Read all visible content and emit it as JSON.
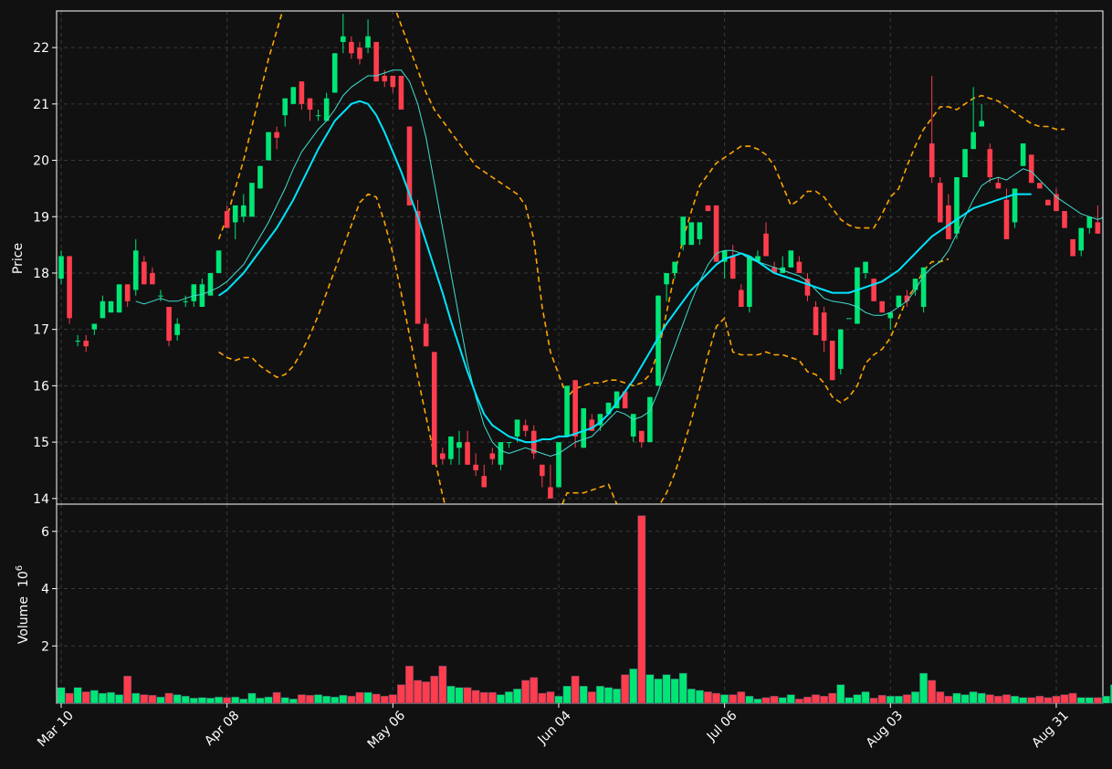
{
  "chart_data": {
    "type": "candlestick",
    "colors": {
      "background": "#111111",
      "grid": "#3a3a3a",
      "up": "#00e676",
      "down": "#ff3d4d",
      "ma_fast": "#40e0d0",
      "ma_slow": "#00e5ff",
      "bollinger": "#ffa500",
      "axis": "#ffffff"
    },
    "price_panel": {
      "ylabel": "Price",
      "ylim": [
        13.9,
        22.65
      ],
      "yticks": [
        "14",
        "15",
        "16",
        "17",
        "18",
        "19",
        "20",
        "21",
        "22"
      ]
    },
    "volume_panel": {
      "ylabel": "Volume",
      "ylabel_multiplier": "10",
      "ylabel_exponent": "6",
      "ylim": [
        0,
        6.95
      ],
      "yticks": [
        "2",
        "4",
        "6"
      ]
    },
    "x_tick_labels": [
      "Mar 10",
      "Apr 08",
      "May 06",
      "Jun 04",
      "Jul 06",
      "Aug 03",
      "Aug 31"
    ],
    "x_tick_index": [
      0,
      20,
      40,
      60,
      80,
      100,
      120
    ],
    "candles": [
      [
        17.9,
        18.4,
        17.8,
        18.3,
        0.55
      ],
      [
        18.3,
        18.3,
        17.1,
        17.2,
        0.35
      ],
      [
        16.8,
        16.9,
        16.7,
        16.8,
        0.55
      ],
      [
        16.8,
        16.9,
        16.6,
        16.7,
        0.4
      ],
      [
        17.0,
        17.1,
        16.9,
        17.1,
        0.45
      ],
      [
        17.2,
        17.6,
        17.2,
        17.5,
        0.35
      ],
      [
        17.3,
        17.5,
        17.3,
        17.5,
        0.38
      ],
      [
        17.3,
        17.8,
        17.3,
        17.8,
        0.3
      ],
      [
        17.8,
        17.8,
        17.4,
        17.5,
        0.95
      ],
      [
        17.7,
        18.6,
        17.6,
        18.4,
        0.35
      ],
      [
        18.2,
        18.3,
        17.8,
        17.8,
        0.3
      ],
      [
        18.0,
        18.1,
        17.8,
        17.8,
        0.28
      ],
      [
        17.6,
        17.7,
        17.5,
        17.6,
        0.22
      ],
      [
        17.4,
        17.4,
        16.7,
        16.8,
        0.35
      ],
      [
        16.9,
        17.2,
        16.8,
        17.1,
        0.3
      ],
      [
        17.5,
        17.6,
        17.4,
        17.5,
        0.25
      ],
      [
        17.5,
        17.8,
        17.4,
        17.8,
        0.18
      ],
      [
        17.4,
        17.9,
        17.4,
        17.8,
        0.2
      ],
      [
        17.6,
        18.0,
        17.6,
        18.0,
        0.18
      ],
      [
        18.0,
        18.4,
        18.0,
        18.4,
        0.22
      ],
      [
        19.1,
        19.2,
        18.8,
        18.8,
        0.2
      ],
      [
        18.9,
        19.2,
        18.6,
        19.2,
        0.22
      ],
      [
        19.0,
        19.4,
        18.9,
        19.2,
        0.15
      ],
      [
        19.0,
        19.6,
        19.0,
        19.6,
        0.35
      ],
      [
        19.5,
        19.9,
        19.5,
        19.9,
        0.18
      ],
      [
        20.0,
        20.5,
        20.0,
        20.5,
        0.22
      ],
      [
        20.5,
        20.6,
        20.2,
        20.4,
        0.38
      ],
      [
        20.8,
        21.0,
        20.6,
        21.1,
        0.2
      ],
      [
        21.0,
        21.3,
        21.0,
        21.3,
        0.15
      ],
      [
        21.4,
        21.4,
        20.9,
        21.0,
        0.3
      ],
      [
        21.1,
        21.1,
        20.7,
        20.9,
        0.28
      ],
      [
        20.8,
        20.9,
        20.7,
        20.8,
        0.3
      ],
      [
        20.7,
        21.2,
        20.7,
        21.1,
        0.25
      ],
      [
        21.2,
        21.9,
        21.2,
        21.9,
        0.22
      ],
      [
        22.1,
        22.6,
        21.9,
        22.2,
        0.28
      ],
      [
        22.1,
        22.2,
        21.8,
        21.9,
        0.25
      ],
      [
        22.0,
        22.1,
        21.7,
        21.8,
        0.38
      ],
      [
        22.0,
        22.5,
        21.9,
        22.2,
        0.38
      ],
      [
        22.1,
        22.1,
        21.4,
        21.4,
        0.32
      ],
      [
        21.5,
        21.6,
        21.3,
        21.4,
        0.25
      ],
      [
        21.5,
        21.5,
        21.2,
        21.3,
        0.3
      ],
      [
        21.5,
        21.5,
        20.9,
        20.9,
        0.65
      ],
      [
        20.6,
        20.6,
        19.2,
        19.2,
        1.3
      ],
      [
        19.1,
        19.3,
        17.1,
        17.1,
        0.8
      ],
      [
        17.1,
        17.2,
        16.7,
        16.7,
        0.75
      ],
      [
        16.6,
        16.6,
        14.6,
        14.6,
        0.95
      ],
      [
        14.8,
        14.9,
        14.6,
        14.7,
        1.3
      ],
      [
        14.7,
        15.1,
        14.6,
        15.1,
        0.6
      ],
      [
        14.9,
        15.2,
        14.6,
        15.0,
        0.55
      ],
      [
        15.0,
        15.2,
        14.6,
        14.6,
        0.55
      ],
      [
        14.6,
        14.8,
        14.4,
        14.5,
        0.45
      ],
      [
        14.4,
        14.6,
        14.2,
        14.2,
        0.38
      ],
      [
        14.8,
        14.9,
        14.6,
        14.7,
        0.38
      ],
      [
        14.6,
        15.0,
        14.5,
        15.0,
        0.3
      ],
      [
        15.0,
        15.0,
        14.9,
        15.0,
        0.4
      ],
      [
        15.1,
        15.4,
        15.0,
        15.4,
        0.5
      ],
      [
        15.3,
        15.4,
        15.1,
        15.2,
        0.8
      ],
      [
        15.2,
        15.3,
        14.7,
        14.8,
        0.9
      ],
      [
        14.6,
        14.6,
        14.2,
        14.4,
        0.35
      ],
      [
        14.2,
        14.6,
        14.0,
        14.0,
        0.4
      ],
      [
        14.2,
        15.0,
        14.2,
        15.0,
        0.25
      ],
      [
        15.1,
        16.0,
        15.1,
        16.0,
        0.6
      ],
      [
        16.1,
        16.1,
        14.9,
        15.1,
        0.95
      ],
      [
        14.9,
        15.6,
        14.9,
        15.6,
        0.6
      ],
      [
        15.4,
        15.5,
        15.2,
        15.2,
        0.4
      ],
      [
        15.3,
        15.5,
        15.2,
        15.5,
        0.6
      ],
      [
        15.5,
        15.7,
        15.5,
        15.7,
        0.55
      ],
      [
        15.6,
        15.9,
        15.6,
        15.9,
        0.5
      ],
      [
        15.9,
        15.8,
        15.6,
        15.6,
        1.0
      ],
      [
        15.1,
        15.5,
        15.0,
        15.5,
        1.2
      ],
      [
        15.2,
        15.2,
        14.9,
        15.0,
        6.55
      ],
      [
        15.0,
        15.8,
        15.0,
        15.8,
        1.0
      ],
      [
        16.0,
        17.6,
        16.0,
        17.6,
        0.85
      ],
      [
        17.8,
        18.0,
        17.5,
        18.0,
        1.0
      ],
      [
        18.0,
        18.2,
        17.9,
        18.2,
        0.85
      ],
      [
        18.5,
        19.0,
        18.4,
        19.0,
        1.05
      ],
      [
        18.5,
        18.9,
        18.5,
        18.9,
        0.5
      ],
      [
        18.6,
        18.9,
        18.5,
        18.9,
        0.45
      ],
      [
        19.2,
        19.2,
        19.1,
        19.1,
        0.4
      ],
      [
        19.2,
        19.2,
        18.2,
        18.2,
        0.35
      ],
      [
        18.2,
        18.4,
        17.9,
        18.4,
        0.3
      ],
      [
        18.3,
        18.5,
        17.9,
        17.9,
        0.3
      ],
      [
        17.7,
        17.8,
        17.4,
        17.4,
        0.4
      ],
      [
        17.4,
        18.3,
        17.3,
        18.3,
        0.25
      ],
      [
        18.2,
        18.4,
        18.2,
        18.3,
        0.15
      ],
      [
        18.7,
        18.9,
        18.4,
        18.3,
        0.2
      ],
      [
        18.1,
        18.2,
        18.1,
        18.0,
        0.25
      ],
      [
        18.0,
        18.3,
        18.0,
        18.1,
        0.2
      ],
      [
        18.1,
        18.4,
        18.1,
        18.4,
        0.3
      ],
      [
        18.2,
        18.3,
        18.0,
        18.0,
        0.15
      ],
      [
        17.9,
        18.0,
        17.5,
        17.6,
        0.22
      ],
      [
        17.4,
        17.5,
        16.9,
        16.9,
        0.3
      ],
      [
        17.3,
        17.4,
        16.6,
        16.8,
        0.25
      ],
      [
        16.8,
        16.8,
        16.1,
        16.1,
        0.35
      ],
      [
        16.3,
        17.0,
        16.2,
        17.0,
        0.65
      ],
      [
        17.2,
        17.2,
        17.2,
        17.2,
        0.2
      ],
      [
        17.1,
        18.1,
        17.1,
        18.1,
        0.3
      ],
      [
        18.0,
        18.2,
        17.9,
        18.2,
        0.4
      ],
      [
        17.9,
        17.9,
        17.5,
        17.5,
        0.18
      ],
      [
        17.5,
        17.5,
        17.3,
        17.3,
        0.28
      ],
      [
        17.2,
        17.3,
        17.0,
        17.3,
        0.25
      ],
      [
        17.4,
        17.6,
        17.4,
        17.6,
        0.25
      ],
      [
        17.6,
        17.7,
        17.4,
        17.5,
        0.3
      ],
      [
        17.7,
        17.9,
        17.6,
        17.9,
        0.4
      ],
      [
        17.4,
        18.1,
        17.3,
        18.1,
        1.05
      ],
      [
        20.3,
        21.5,
        19.6,
        19.7,
        0.8
      ],
      [
        19.6,
        19.7,
        18.9,
        18.9,
        0.4
      ],
      [
        19.2,
        19.4,
        18.6,
        18.6,
        0.25
      ],
      [
        18.7,
        19.7,
        18.6,
        19.7,
        0.35
      ],
      [
        19.7,
        20.2,
        19.7,
        20.2,
        0.3
      ],
      [
        20.2,
        21.3,
        20.2,
        20.5,
        0.4
      ],
      [
        20.6,
        21.0,
        20.6,
        20.7,
        0.35
      ],
      [
        20.2,
        20.3,
        19.6,
        19.7,
        0.3
      ],
      [
        19.6,
        19.7,
        19.5,
        19.5,
        0.25
      ],
      [
        19.3,
        19.5,
        18.6,
        18.6,
        0.3
      ],
      [
        18.9,
        19.5,
        18.8,
        19.5,
        0.25
      ],
      [
        19.9,
        20.3,
        19.9,
        20.3,
        0.2
      ],
      [
        20.1,
        20.1,
        19.6,
        19.6,
        0.2
      ],
      [
        19.6,
        19.6,
        19.5,
        19.5,
        0.25
      ],
      [
        19.3,
        19.3,
        19.2,
        19.2,
        0.2
      ],
      [
        19.4,
        19.5,
        19.1,
        19.1,
        0.25
      ],
      [
        19.1,
        19.1,
        18.8,
        18.8,
        0.3
      ],
      [
        18.6,
        18.6,
        18.3,
        18.3,
        0.35
      ],
      [
        18.4,
        18.8,
        18.3,
        18.8,
        0.2
      ],
      [
        18.8,
        19.0,
        18.7,
        19.0,
        0.2
      ],
      [
        18.9,
        19.2,
        18.7,
        18.7,
        0.2
      ],
      [
        18.9,
        19.2,
        18.9,
        19.1,
        0.25
      ],
      [
        18.9,
        19.2,
        18.5,
        19.2,
        0.65
      ]
    ],
    "ma_fast": [
      null,
      null,
      null,
      null,
      null,
      null,
      null,
      null,
      null,
      17.5,
      17.45,
      17.5,
      17.55,
      17.5,
      17.5,
      17.55,
      17.6,
      17.62,
      17.68,
      17.75,
      17.85,
      18.0,
      18.15,
      18.4,
      18.65,
      18.9,
      19.2,
      19.5,
      19.85,
      20.15,
      20.35,
      20.55,
      20.7,
      20.9,
      21.15,
      21.3,
      21.4,
      21.5,
      21.5,
      21.55,
      21.6,
      21.6,
      21.4,
      21.0,
      20.4,
      19.6,
      18.8,
      18.0,
      17.2,
      16.4,
      15.8,
      15.3,
      15.0,
      14.85,
      14.8,
      14.85,
      14.9,
      14.85,
      14.8,
      14.75,
      14.8,
      14.9,
      15.0,
      15.05,
      15.1,
      15.25,
      15.4,
      15.55,
      15.5,
      15.4,
      15.45,
      15.55,
      15.9,
      16.3,
      16.7,
      17.1,
      17.5,
      17.85,
      18.15,
      18.35,
      18.4,
      18.4,
      18.35,
      18.25,
      18.2,
      18.15,
      18.1,
      18.05,
      18.0,
      17.95,
      17.85,
      17.7,
      17.55,
      17.5,
      17.48,
      17.45,
      17.4,
      17.3,
      17.25,
      17.25,
      17.3,
      17.4,
      17.5,
      17.7,
      17.95,
      18.1,
      18.2,
      18.4,
      18.7,
      19.0,
      19.3,
      19.55,
      19.65,
      19.7,
      19.65,
      19.75,
      19.85,
      19.8,
      19.65,
      19.5,
      19.35,
      19.25,
      19.15,
      19.05,
      19.0,
      18.95,
      19.0,
      19.05
    ],
    "ma_slow": [
      null,
      null,
      null,
      null,
      null,
      null,
      null,
      null,
      null,
      null,
      null,
      null,
      null,
      null,
      null,
      null,
      null,
      null,
      null,
      17.6,
      17.7,
      17.85,
      18.0,
      18.2,
      18.4,
      18.6,
      18.8,
      19.05,
      19.3,
      19.6,
      19.9,
      20.2,
      20.45,
      20.7,
      20.85,
      21.0,
      21.05,
      21.0,
      20.8,
      20.5,
      20.15,
      19.8,
      19.4,
      19.0,
      18.55,
      18.1,
      17.65,
      17.15,
      16.7,
      16.25,
      15.85,
      15.5,
      15.3,
      15.2,
      15.1,
      15.05,
      15.0,
      15.0,
      15.05,
      15.05,
      15.1,
      15.1,
      15.15,
      15.2,
      15.25,
      15.35,
      15.5,
      15.7,
      15.9,
      16.1,
      16.35,
      16.6,
      16.85,
      17.1,
      17.3,
      17.5,
      17.7,
      17.85,
      18.0,
      18.15,
      18.25,
      18.3,
      18.35,
      18.3,
      18.2,
      18.1,
      18.0,
      17.95,
      17.9,
      17.85,
      17.8,
      17.75,
      17.7,
      17.65,
      17.65,
      17.65,
      17.7,
      17.75,
      17.8,
      17.85,
      17.95,
      18.05,
      18.2,
      18.35,
      18.5,
      18.65,
      18.75,
      18.85,
      18.95,
      19.05,
      19.15,
      19.2,
      19.25,
      19.3,
      19.35,
      19.4,
      19.4,
      19.4
    ],
    "bb_upper": [
      null,
      null,
      null,
      null,
      null,
      null,
      null,
      null,
      null,
      null,
      null,
      null,
      null,
      null,
      null,
      null,
      null,
      null,
      null,
      18.6,
      19.0,
      19.5,
      20.0,
      20.6,
      21.2,
      21.8,
      22.3,
      22.8,
      23.2,
      23.6,
      23.9,
      24.1,
      24.3,
      24.4,
      24.4,
      24.3,
      24.1,
      23.9,
      23.6,
      23.2,
      22.8,
      22.4,
      22.0,
      21.6,
      21.2,
      20.9,
      20.7,
      20.5,
      20.3,
      20.1,
      19.9,
      19.8,
      19.7,
      19.6,
      19.5,
      19.4,
      19.2,
      18.6,
      17.4,
      16.6,
      16.2,
      15.8,
      15.95,
      16.0,
      16.05,
      16.05,
      16.1,
      16.1,
      16.05,
      16.0,
      16.05,
      16.2,
      16.6,
      17.3,
      18.0,
      18.6,
      19.1,
      19.55,
      19.75,
      19.95,
      20.05,
      20.15,
      20.25,
      20.25,
      20.2,
      20.1,
      19.9,
      19.55,
      19.2,
      19.3,
      19.45,
      19.45,
      19.35,
      19.15,
      18.95,
      18.85,
      18.8,
      18.8,
      18.8,
      19.05,
      19.35,
      19.5,
      19.9,
      20.25,
      20.55,
      20.75,
      20.95,
      20.95,
      20.9,
      21.0,
      21.1,
      21.15,
      21.1,
      21.05,
      20.95,
      20.85,
      20.75,
      20.65,
      20.6,
      20.6,
      20.55,
      20.55
    ],
    "bb_lower": [
      null,
      null,
      null,
      null,
      null,
      null,
      null,
      null,
      null,
      null,
      null,
      null,
      null,
      null,
      null,
      null,
      null,
      null,
      null,
      16.6,
      16.5,
      16.45,
      16.5,
      16.5,
      16.35,
      16.25,
      16.15,
      16.2,
      16.35,
      16.6,
      16.9,
      17.25,
      17.65,
      18.05,
      18.45,
      18.85,
      19.25,
      19.4,
      19.35,
      18.9,
      18.35,
      17.65,
      16.9,
      16.15,
      15.45,
      14.75,
      14.05,
      13.5,
      13.05,
      12.7,
      12.4,
      12.15,
      12.0,
      11.95,
      12.0,
      12.1,
      12.25,
      12.5,
      12.85,
      13.3,
      13.75,
      14.1,
      14.1,
      14.1,
      14.15,
      14.2,
      14.25,
      13.9,
      13.55,
      13.35,
      13.45,
      13.6,
      13.85,
      14.1,
      14.45,
      14.9,
      15.4,
      15.95,
      16.55,
      17.05,
      17.2,
      16.6,
      16.55,
      16.55,
      16.55,
      16.6,
      16.55,
      16.55,
      16.5,
      16.45,
      16.25,
      16.2,
      16.05,
      15.8,
      15.7,
      15.8,
      16.0,
      16.4,
      16.55,
      16.65,
      16.85,
      17.2,
      17.55,
      17.75,
      18.05,
      18.2,
      18.2,
      18.25
    ]
  }
}
